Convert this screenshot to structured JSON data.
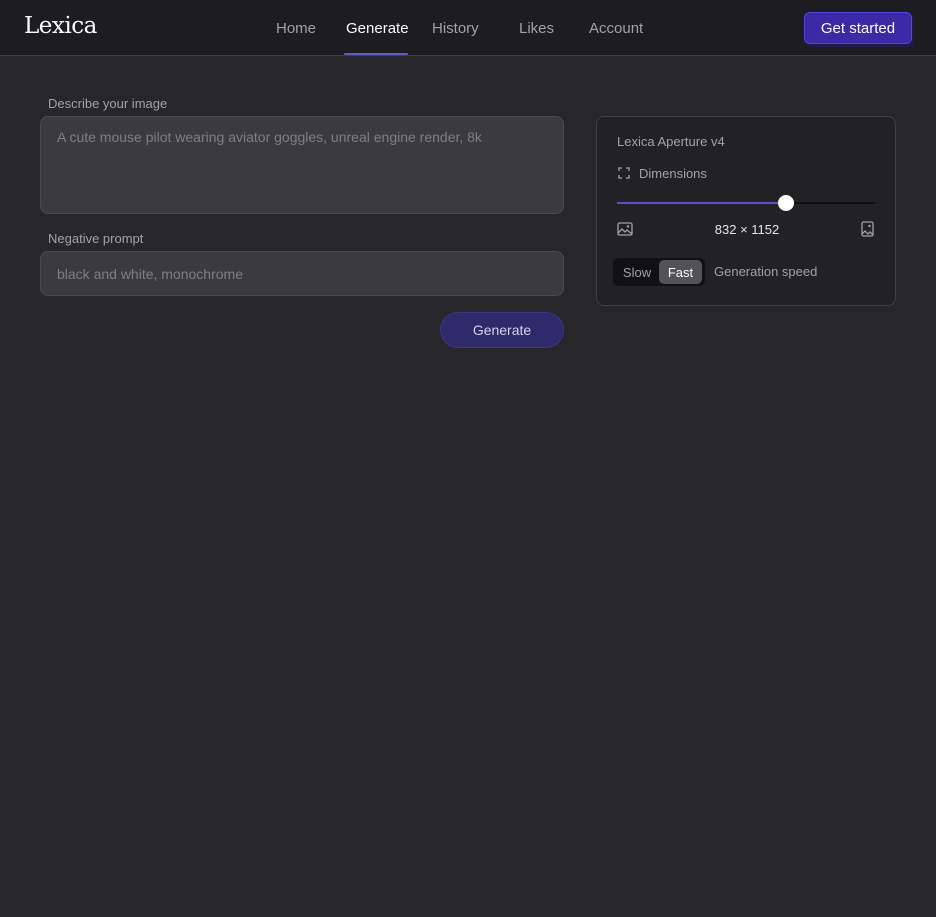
{
  "header": {
    "logo": "Lexica",
    "nav": [
      {
        "label": "Home",
        "active": false
      },
      {
        "label": "Generate",
        "active": true
      },
      {
        "label": "History",
        "active": false
      },
      {
        "label": "Likes",
        "active": false
      },
      {
        "label": "Account",
        "active": false
      }
    ],
    "cta_label": "Get started"
  },
  "form": {
    "prompt_label": "Describe your image",
    "prompt_placeholder": "A cute mouse pilot wearing aviator goggles, unreal engine render, 8k",
    "negative_label": "Negative prompt",
    "negative_placeholder": "black and white, monochrome",
    "generate_label": "Generate"
  },
  "settings": {
    "model": "Lexica Aperture v4",
    "dimensions_label": "Dimensions",
    "dimensions_value": "832 × 1152",
    "slider_fraction": 0.655,
    "speed_options": [
      "Slow",
      "Fast"
    ],
    "speed_selected": "Fast",
    "speed_label": "Generation speed"
  },
  "colors": {
    "accent": "#5b4fd6",
    "background": "#27272a",
    "header": "#1d1d20"
  }
}
